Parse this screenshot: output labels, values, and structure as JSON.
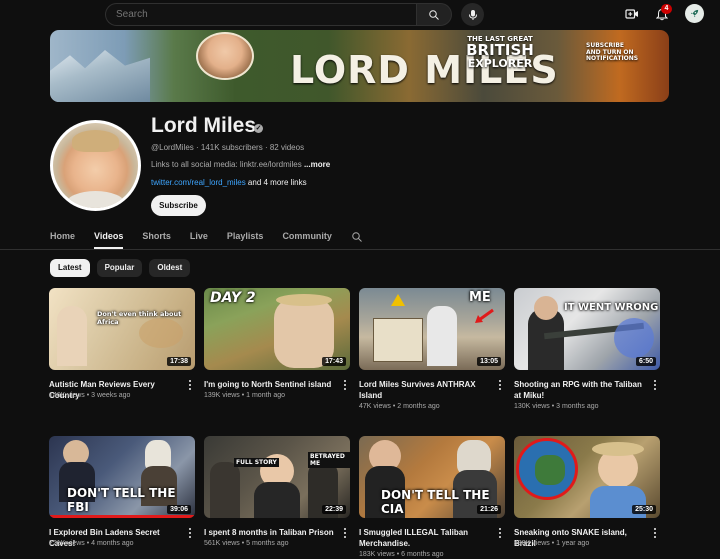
{
  "topbar": {
    "search_placeholder": "Search",
    "notifications_count": "4"
  },
  "banner": {
    "title": "LORD MILES",
    "subtitle_line1": "THE LAST GREAT",
    "subtitle_line2": "BRITISH",
    "subtitle_line3": "EXPLORER",
    "cta_line1": "SUBSCRIBE",
    "cta_line2": "AND TURN ON",
    "cta_line3": "NOTIFICATIONS"
  },
  "channel": {
    "name": "Lord Miles",
    "handle_stats": "@LordMiles · 141K subscribers · 82 videos",
    "description": "Links to all social media: linktr.ee/lordmiles ",
    "more_label": "...more",
    "link_text": "twitter.com/real_lord_miles",
    "more_links": " and 4 more links",
    "subscribe_label": "Subscribe"
  },
  "tabs": [
    {
      "label": "Home"
    },
    {
      "label": "Videos",
      "active": true
    },
    {
      "label": "Shorts"
    },
    {
      "label": "Live"
    },
    {
      "label": "Playlists"
    },
    {
      "label": "Community"
    }
  ],
  "chips": [
    {
      "label": "Latest",
      "active": true
    },
    {
      "label": "Popular"
    },
    {
      "label": "Oldest"
    }
  ],
  "videos": [
    {
      "title": "Autistic Man Reviews Every Country",
      "meta": "146K views • 3 weeks ago",
      "duration": "17:38",
      "thumb_text": "Don't even think about Africa"
    },
    {
      "title": "I'm going to North Sentinel island",
      "meta": "139K views • 1 month ago",
      "duration": "17:43",
      "thumb_text": "DAY 2"
    },
    {
      "title": "Lord Miles Survives ANTHRAX Island",
      "meta": "47K views • 2 months ago",
      "duration": "13:05",
      "thumb_text": "ME"
    },
    {
      "title": "Shooting an RPG with the Taliban at Miku!",
      "meta": "130K views • 3 months ago",
      "duration": "6:50",
      "thumb_text": "IT WENT WRONG"
    },
    {
      "title": "I Explored Bin Ladens Secret Caves!",
      "meta": "221K views • 4 months ago",
      "duration": "39:06",
      "thumb_text": "DON'T TELL THE FBI"
    },
    {
      "title": "I spent 8 months in Taliban Prison",
      "meta": "561K views • 5 months ago",
      "duration": "22:39",
      "thumb_text": "FULL STORY",
      "thumb_text2": "BETRAYED ME"
    },
    {
      "title": "I Smuggled ILLEGAL Taliban Merchandise.",
      "meta": "183K views • 6 months ago",
      "duration": "21:26",
      "thumb_text": "DON'T TELL THE CIA"
    },
    {
      "title": "Sneaking onto SNAKE island, Brazil",
      "meta": "498K views • 1 year ago",
      "duration": "25:30"
    }
  ]
}
